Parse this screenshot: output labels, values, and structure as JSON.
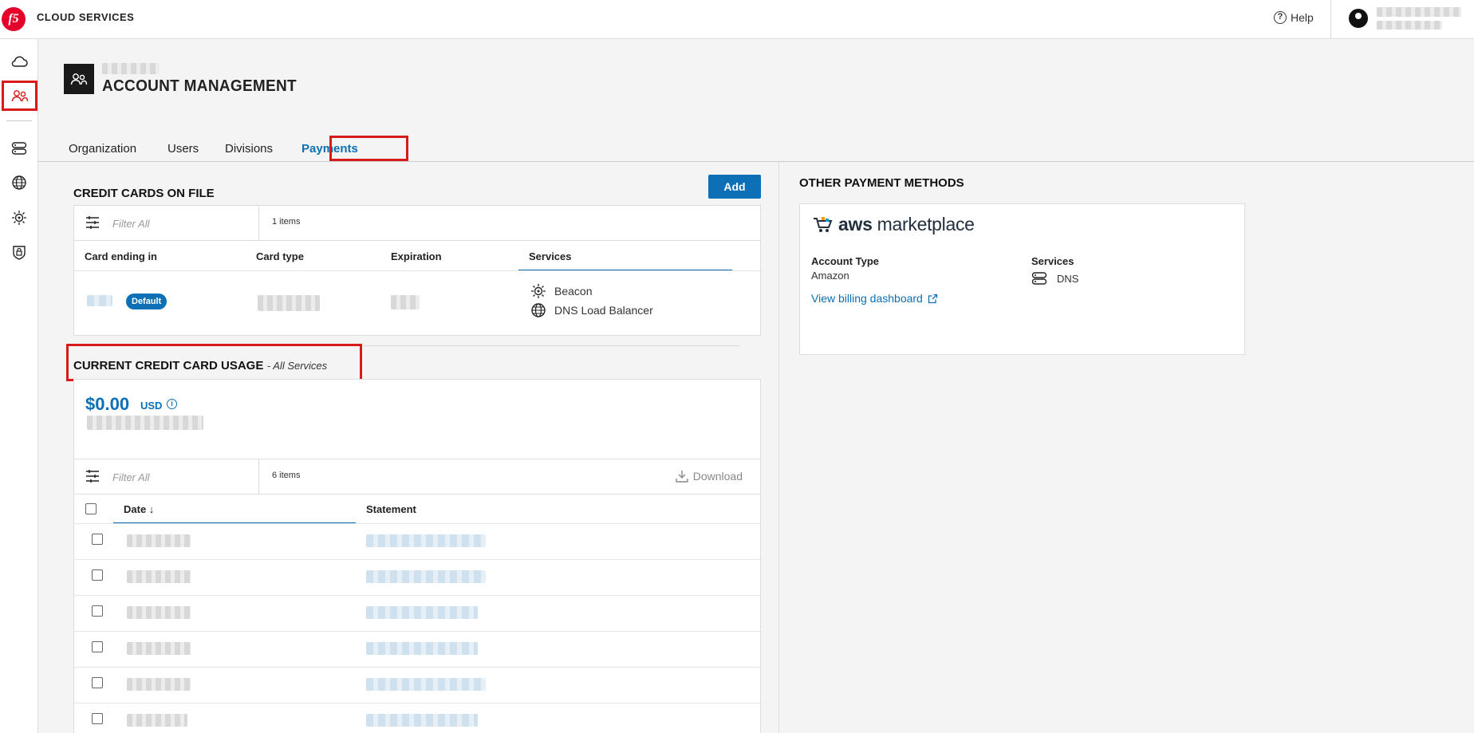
{
  "app": {
    "title": "CLOUD SERVICES",
    "help_label": "Help"
  },
  "page": {
    "title": "ACCOUNT MANAGEMENT"
  },
  "tabs": [
    {
      "label": "Organization"
    },
    {
      "label": "Users"
    },
    {
      "label": "Divisions"
    },
    {
      "label": "Payments",
      "active": true
    }
  ],
  "credit_cards": {
    "heading": "CREDIT CARDS ON FILE",
    "add_label": "Add",
    "filter_placeholder": "Filter All",
    "items_count": "1 items",
    "columns": [
      "Card ending in",
      "Card type",
      "Expiration",
      "Services"
    ],
    "rows": [
      {
        "badge": "Default",
        "services": [
          "Beacon",
          "DNS Load Balancer"
        ]
      }
    ]
  },
  "usage": {
    "heading": "CURRENT CREDIT CARD USAGE",
    "subheading": "- All Services",
    "amount": "$0.00",
    "currency": "USD",
    "filter_placeholder": "Filter All",
    "items_count": "6 items",
    "download_label": "Download",
    "columns": [
      "Date ↓",
      "Statement"
    ]
  },
  "other_payments": {
    "heading": "OTHER PAYMENT METHODS",
    "provider_logo": "aws marketplace",
    "account_type_label": "Account Type",
    "account_type_value": "Amazon",
    "services_label": "Services",
    "services_value": "DNS",
    "billing_link": "View billing dashboard"
  },
  "colors": {
    "accent": "#0d6fb5",
    "highlight": "#d71a1a",
    "brand": "#e4002b"
  }
}
